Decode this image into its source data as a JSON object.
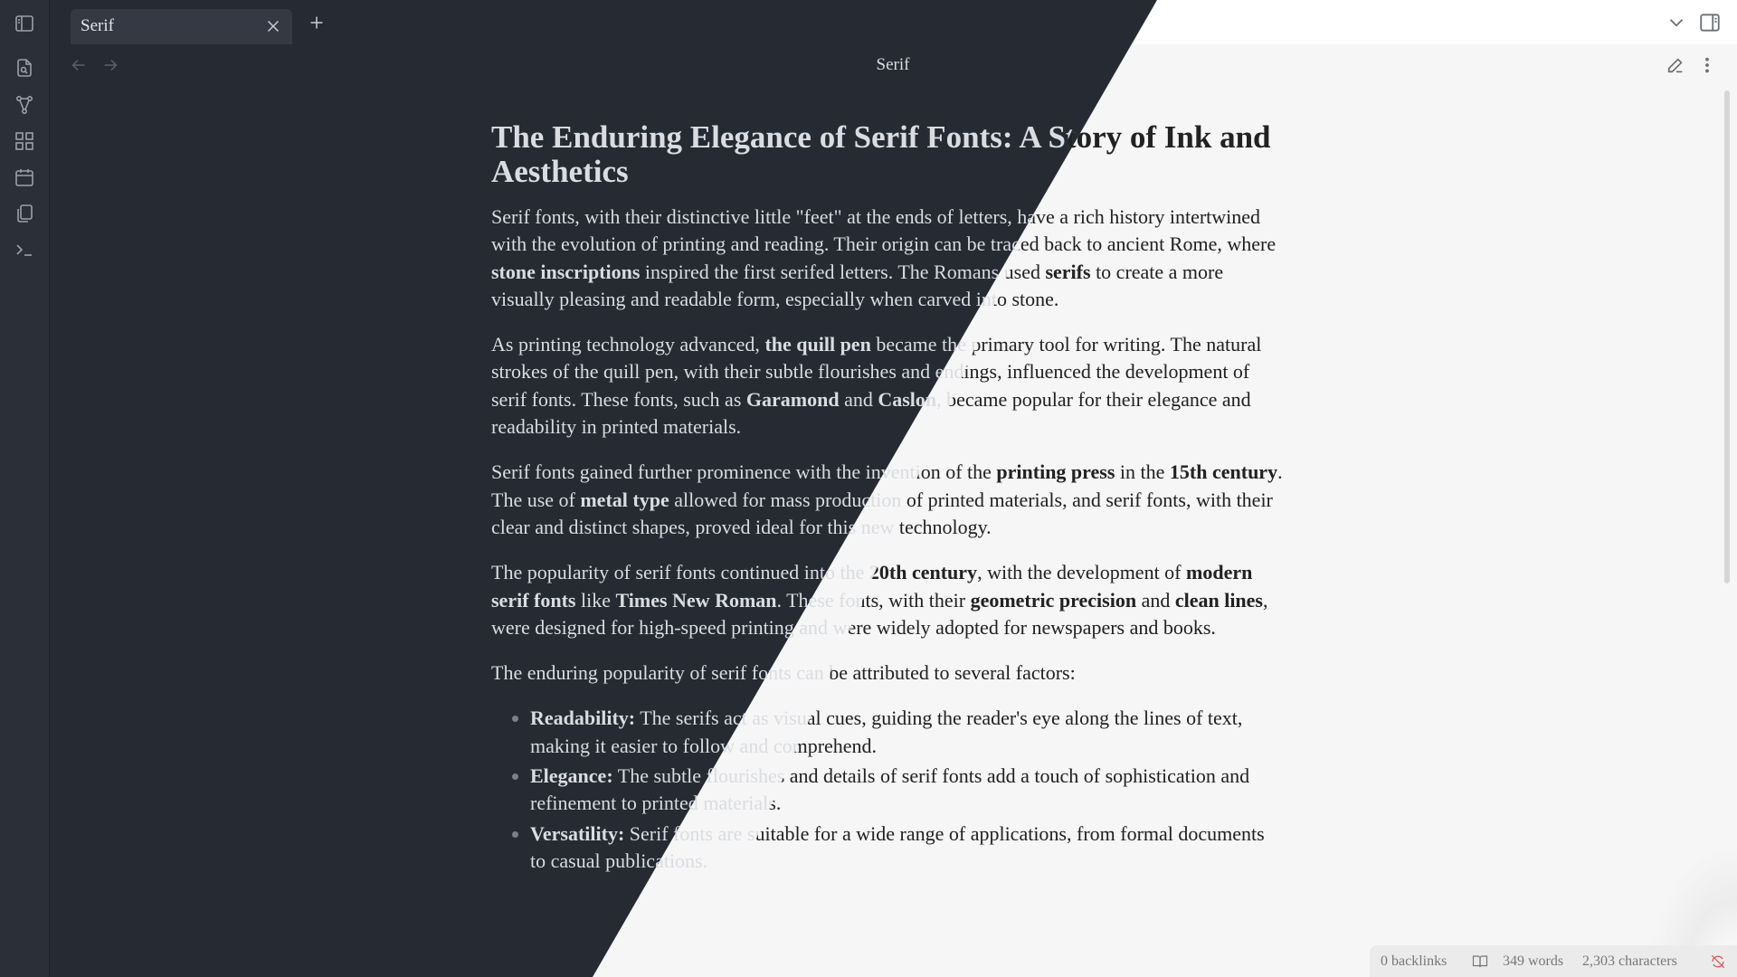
{
  "colors": {
    "dark_bg": "#262a33",
    "light_bg": "#f6f6f6",
    "dark_text": "#dadce0",
    "light_text": "#222222",
    "status_sync_error": "#e04e4e"
  },
  "ribbon": {
    "icons": [
      "sidebar-toggle-icon",
      "quick-switcher-icon",
      "graph-view-icon",
      "canvas-icon",
      "daily-notes-icon",
      "templates-icon",
      "command-palette-icon"
    ]
  },
  "tabbar": {
    "tabs": [
      {
        "label": "Serif"
      }
    ],
    "new_tab_icon": "plus-icon",
    "tab_list_icon": "chevron-down-icon",
    "right_sidebar_icon": "sidebar-right-icon"
  },
  "view_header": {
    "title": "Serif",
    "back_icon": "arrow-left-icon",
    "forward_icon": "arrow-right-icon",
    "edit_icon": "pencil-icon",
    "more_icon": "more-vertical-icon"
  },
  "document": {
    "heading": "The Enduring Elegance of Serif Fonts: A Story of Ink and Aesthetics",
    "p1": {
      "t1": "Serif fonts, with their distinctive little \"feet\" at the ends of letters, have a rich history intertwined with the evolution of printing and reading. Their origin can be traced back to ancient Rome, where ",
      "b1": "stone inscriptions",
      "t2": " inspired the first serifed letters. The Romans used ",
      "b2": "serifs",
      "t3": " to create a more visually pleasing and readable form, especially when carved into stone."
    },
    "p2": {
      "t1": "As printing technology advanced, ",
      "b1": "the quill pen",
      "t2": " became the primary tool for writing. The natural strokes of the quill pen, with their subtle flourishes and endings, influenced the development of serif fonts. These fonts, such as ",
      "b2": "Garamond",
      "t3": " and ",
      "b3": "Caslon",
      "t4": ", became popular for their elegance and readability in printed materials."
    },
    "p3": {
      "t1": "Serif fonts gained further prominence with the invention of the ",
      "b1": "printing press",
      "t2": " in the ",
      "b2": "15th century",
      "t3": ". The use of ",
      "b3": "metal type",
      "t4": " allowed for mass production of printed materials, and serif fonts, with their clear and distinct shapes, proved ideal for this new technology."
    },
    "p4": {
      "t1": "The popularity of serif fonts continued into the ",
      "b1": "20th century",
      "t2": ", with the development of ",
      "b2": "modern serif fonts",
      "t3": " like ",
      "b3": "Times New Roman",
      "t4": ". These fonts, with their ",
      "b4": "geometric precision",
      "t5": " and ",
      "b5": "clean lines",
      "t6": ", were designed for high-speed printing and were widely adopted for newspapers and books."
    },
    "p5": "The enduring popularity of serif fonts can be attributed to several factors:",
    "list": [
      {
        "term": "Readability:",
        "text": " The serifs act as visual cues, guiding the reader's eye along the lines of text, making it easier to follow and comprehend."
      },
      {
        "term": "Elegance:",
        "text": " The subtle flourishes and details of serif fonts add a touch of sophistication and refinement to printed materials."
      },
      {
        "term": "Versatility:",
        "text": " Serif fonts are suitable for a wide range of applications, from formal documents to casual publications."
      }
    ]
  },
  "status_bar": {
    "backlinks": "0 backlinks",
    "reading_icon": "book-open-icon",
    "words": "349 words",
    "characters": "2,303 characters",
    "sync_icon": "sync-off-icon"
  }
}
